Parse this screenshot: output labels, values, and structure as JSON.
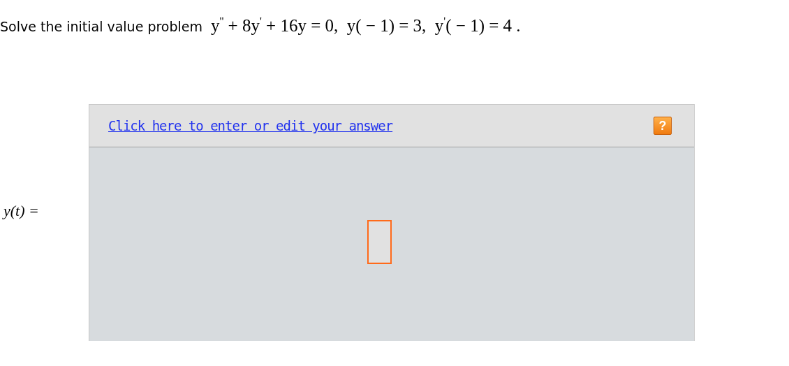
{
  "prompt": {
    "text": "Solve the initial value problem",
    "equation": "y$^{''}$ + 8y$^{'}$ + 16y = 0,  y( − 1) = 3,  y$^{'}$( − 1) = 4 ."
  },
  "answer": {
    "label": "y(t) =",
    "edit_link": "Click here to enter or edit your answer",
    "help_button": "?"
  }
}
